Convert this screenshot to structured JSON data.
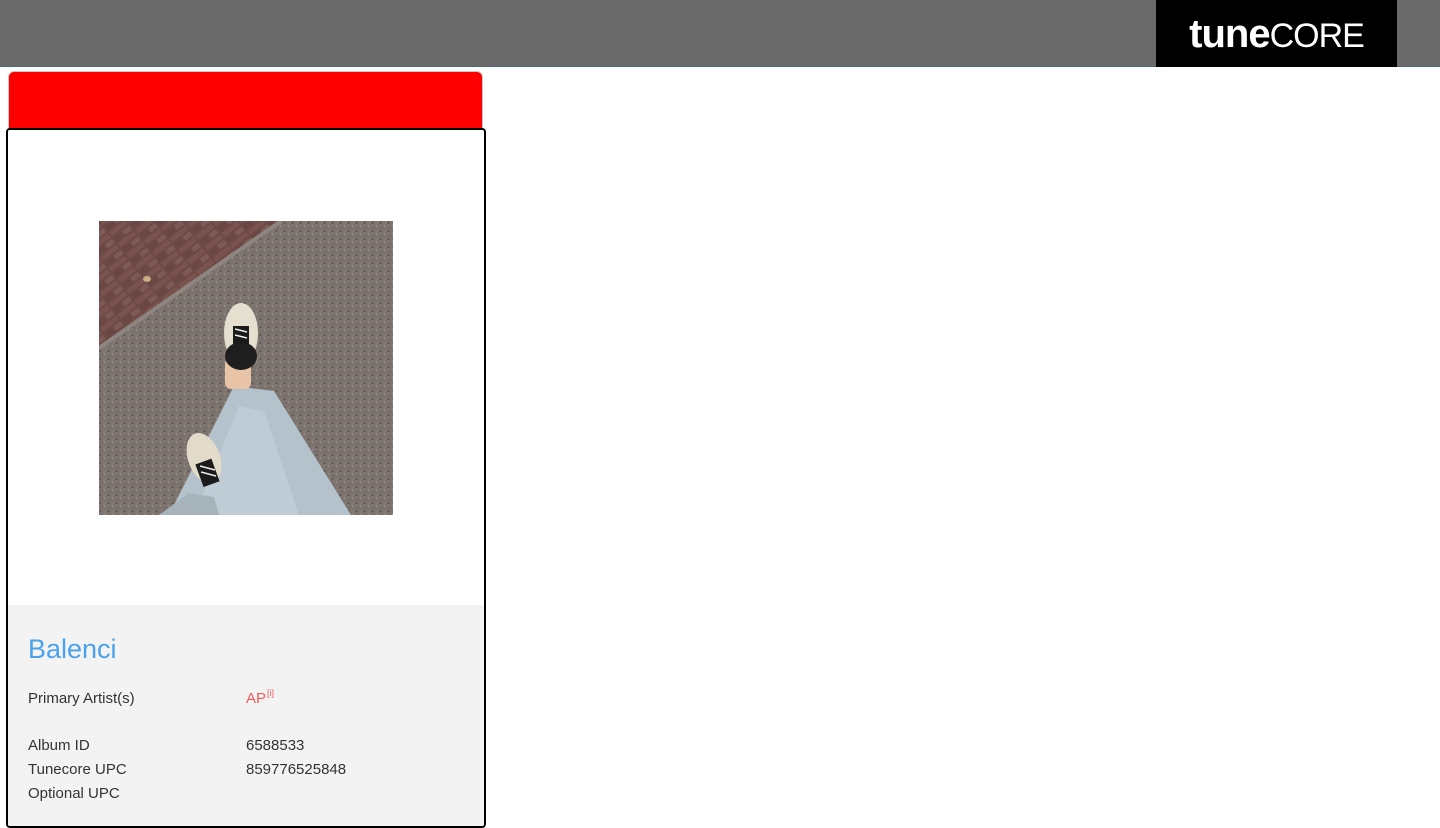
{
  "header": {
    "logo": {
      "part1": "tune",
      "part2": "CORE"
    },
    "colors": {
      "bar": "#6a6a6a",
      "logo_bg": "#000000"
    }
  },
  "card": {
    "tab_color": "#ff0000",
    "artwork": {
      "icon": "album-artwork-photo"
    },
    "title": "Balenci",
    "primary_artist_label": "Primary Artist(s)",
    "primary_artist_value": "AP",
    "primary_artist_marker": "[i]",
    "rows": [
      {
        "label": "Album ID",
        "value": "6588533"
      },
      {
        "label": "Tunecore UPC",
        "value": "859776525848"
      },
      {
        "label": "Optional UPC",
        "value": ""
      }
    ],
    "colors": {
      "title": "#4aa3ec",
      "artist_link": "#f25a5a",
      "info_bg": "#f3f3f3"
    }
  }
}
